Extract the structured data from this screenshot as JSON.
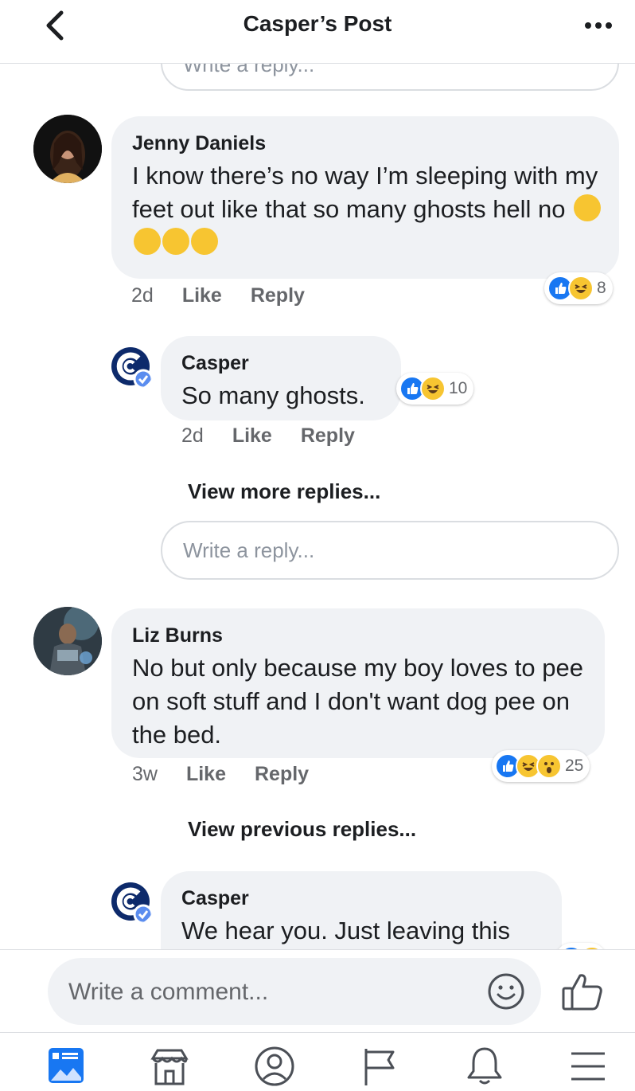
{
  "header": {
    "title": "Casper’s Post"
  },
  "comments": [
    {
      "author": "Jenny Daniels",
      "text": "I know there’s no way I’m sleeping with my feet out like that so many ghosts hell no",
      "emojis": [
        "thinking-face",
        "rolling-laughing-face",
        "tears-of-joy-face",
        "rolling-laughing-face"
      ],
      "time": "2d",
      "like_label": "Like",
      "reply_label": "Reply",
      "reaction_count": "8",
      "reactions": [
        "like",
        "haha"
      ],
      "replies": [
        {
          "author": "Casper",
          "text": "So many ghosts.",
          "time": "2d",
          "like_label": "Like",
          "reply_label": "Reply",
          "reaction_count": "10",
          "reactions": [
            "like",
            "haha"
          ]
        }
      ],
      "view_more_label": "View more replies...",
      "reply_placeholder": "Write a reply..."
    },
    {
      "author": "Liz Burns",
      "text": "No but only because my boy loves to pee on soft stuff and I don't want dog pee on the bed.",
      "time": "3w",
      "like_label": "Like",
      "reply_label": "Reply",
      "reaction_count": "25",
      "reactions": [
        "like",
        "haha",
        "wow"
      ],
      "view_previous_label": "View previous replies...",
      "replies": [
        {
          "author": "Casper",
          "text": "We hear you. Just leaving this"
        }
      ]
    }
  ],
  "top_reply_placeholder": "Write a reply...",
  "composer": {
    "placeholder": "Write a comment..."
  },
  "colors": {
    "accent": "#1877f2",
    "bubble": "#f0f2f5",
    "haha": "#f7c531",
    "casper_brand": "#0d2a6b"
  },
  "tabbar": [
    "news-feed-icon",
    "marketplace-icon",
    "profile-icon",
    "pages-flag-icon",
    "notifications-bell-icon",
    "menu-icon"
  ]
}
